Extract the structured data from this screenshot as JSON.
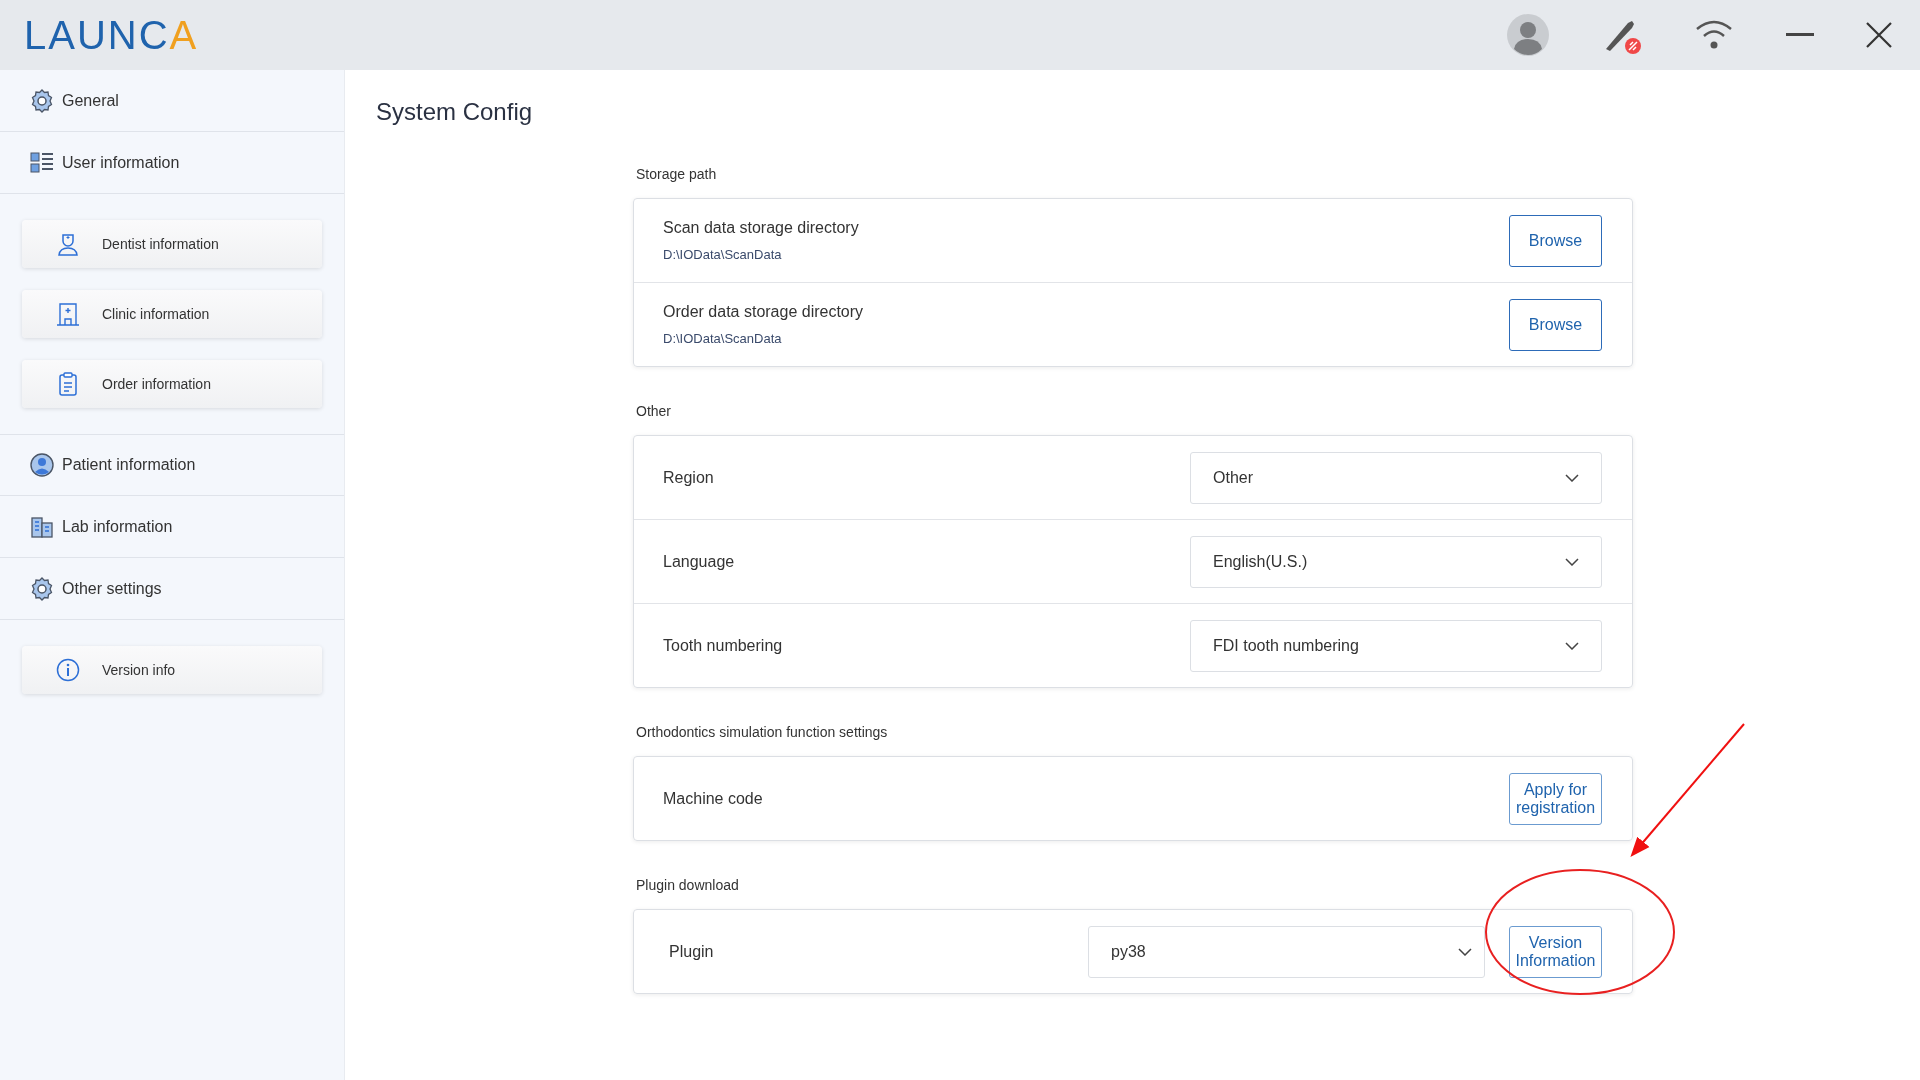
{
  "logo": {
    "main": "LAUNC",
    "accent": "A"
  },
  "sidebar": {
    "items": [
      {
        "kind": "section",
        "label": "General"
      },
      {
        "kind": "section",
        "label": "User information"
      },
      {
        "kind": "card",
        "label": "Dentist information"
      },
      {
        "kind": "card",
        "label": "Clinic information"
      },
      {
        "kind": "card",
        "label": "Order information"
      },
      {
        "kind": "section",
        "label": "Patient information"
      },
      {
        "kind": "section",
        "label": "Lab information"
      },
      {
        "kind": "section",
        "label": "Other settings"
      },
      {
        "kind": "card",
        "label": "Version info"
      }
    ]
  },
  "page_title": "System Config",
  "sections": [
    {
      "title": "Storage path",
      "rows": [
        {
          "kind": "path",
          "label": "Scan data storage directory",
          "value": "D:\\IOData\\ScanData",
          "button": "Browse"
        },
        {
          "kind": "path",
          "label": "Order data storage directory",
          "value": "D:\\IOData\\ScanData",
          "button": "Browse"
        }
      ]
    },
    {
      "title": "Other",
      "rows": [
        {
          "kind": "select",
          "label": "Region",
          "value": "Other"
        },
        {
          "kind": "select",
          "label": "Language",
          "value": "English(U.S.)"
        },
        {
          "kind": "select",
          "label": "Tooth numbering",
          "value": "FDI tooth numbering"
        }
      ]
    },
    {
      "title": "Orthodontics simulation function settings",
      "rows": [
        {
          "kind": "action",
          "label": "Machine code",
          "button": "Apply for registration"
        }
      ]
    },
    {
      "title": "Plugin download",
      "rows": [
        {
          "kind": "select_button",
          "label": "Plugin",
          "value": "py38",
          "button": "Version Information"
        }
      ]
    }
  ]
}
